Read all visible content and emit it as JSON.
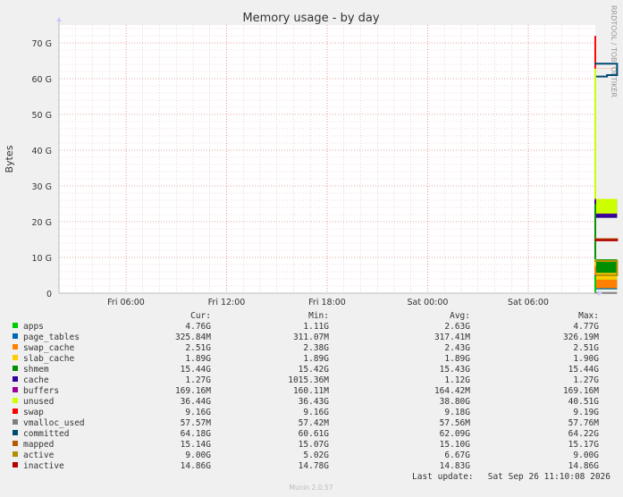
{
  "chart_data": {
    "type": "area",
    "title": "Memory usage - by day",
    "ylabel": "Bytes",
    "xlabel": "",
    "side_label": "RRDTOOL / TOBI OETIKER",
    "footer": "Munin 2.0.57",
    "ylim": [
      0,
      75
    ],
    "y_unit": "G",
    "y_ticks": [
      {
        "value": 0,
        "label": "0"
      },
      {
        "value": 10,
        "label": "10 G"
      },
      {
        "value": 20,
        "label": "20 G"
      },
      {
        "value": 30,
        "label": "30 G"
      },
      {
        "value": 40,
        "label": "40 G"
      },
      {
        "value": 50,
        "label": "50 G"
      },
      {
        "value": 60,
        "label": "60 G"
      },
      {
        "value": 70,
        "label": "70 G"
      }
    ],
    "x_hours_range": [
      0,
      32
    ],
    "x_ticks": [
      {
        "hour": 4,
        "label": "Fri 06:00"
      },
      {
        "hour": 10,
        "label": "Fri 12:00"
      },
      {
        "hour": 16,
        "label": "Fri 18:00"
      },
      {
        "hour": 22,
        "label": "Sat 00:00"
      },
      {
        "hour": 28,
        "label": "Sat 06:00"
      }
    ],
    "grid": true,
    "legend_headers": [
      "Cur:",
      "Min:",
      "Avg:",
      "Max:"
    ],
    "stack_hours": [
      32.05,
      32.7,
      33.3
    ],
    "series": [
      {
        "name": "apps",
        "color": "#00cc00",
        "kind": "area",
        "values": [
          1.1,
          1.1,
          4.76
        ],
        "cur": "4.76G",
        "min": "1.11G",
        "avg": "2.63G",
        "max": "4.77G"
      },
      {
        "name": "page_tables",
        "color": "#0066b3",
        "kind": "area",
        "values": [
          0.31,
          0.31,
          0.32
        ],
        "cur": "325.84M",
        "min": "311.07M",
        "avg": "317.41M",
        "max": "326.19M"
      },
      {
        "name": "swap_cache",
        "color": "#ff8000",
        "kind": "area",
        "values": [
          2.38,
          2.38,
          2.51
        ],
        "cur": "2.51G",
        "min": "2.38G",
        "avg": "2.43G",
        "max": "2.51G"
      },
      {
        "name": "slab_cache",
        "color": "#ffcc00",
        "kind": "area",
        "values": [
          1.89,
          1.89,
          1.89
        ],
        "cur": "1.89G",
        "min": "1.89G",
        "avg": "1.89G",
        "max": "1.90G"
      },
      {
        "name": "shmem",
        "color": "#008f00",
        "kind": "area",
        "values": [
          15.42,
          15.42,
          15.44
        ],
        "cur": "15.44G",
        "min": "15.42G",
        "avg": "15.43G",
        "max": "15.44G"
      },
      {
        "name": "cache",
        "color": "#330099",
        "kind": "area",
        "values": [
          1.02,
          1.02,
          1.27
        ],
        "cur": "1.27G",
        "min": "1015.36M",
        "avg": "1.12G",
        "max": "1.27G"
      },
      {
        "name": "buffers",
        "color": "#990099",
        "kind": "area",
        "values": [
          0.16,
          0.16,
          0.17
        ],
        "cur": "169.16M",
        "min": "160.11M",
        "avg": "164.42M",
        "max": "169.16M"
      },
      {
        "name": "unused",
        "color": "#ccff00",
        "kind": "area",
        "values": [
          40.5,
          40.5,
          36.44
        ],
        "cur": "36.44G",
        "min": "36.43G",
        "avg": "38.80G",
        "max": "40.51G"
      },
      {
        "name": "swap",
        "color": "#ff0000",
        "kind": "area",
        "values": [
          9.18,
          9.18,
          9.16
        ],
        "cur": "9.16G",
        "min": "9.16G",
        "avg": "9.18G",
        "max": "9.19G"
      },
      {
        "name": "vmalloc_used",
        "color": "#808080",
        "kind": "line",
        "values": [
          0.058,
          0.058,
          0.058
        ],
        "cur": "57.57M",
        "min": "57.42M",
        "avg": "57.56M",
        "max": "57.76M"
      },
      {
        "name": "committed",
        "color": "#004b73",
        "kind": "line",
        "values": [
          60.6,
          61.0,
          64.18
        ],
        "cur": "64.18G",
        "min": "60.61G",
        "avg": "62.09G",
        "max": "64.22G"
      },
      {
        "name": "mapped",
        "color": "#b35a00",
        "kind": "line",
        "values": [
          15.07,
          15.1,
          15.14
        ],
        "cur": "15.14G",
        "min": "15.07G",
        "avg": "15.10G",
        "max": "15.17G"
      },
      {
        "name": "active",
        "color": "#b38f00",
        "kind": "line",
        "values": [
          5.02,
          5.02,
          9.0
        ],
        "cur": "9.00G",
        "min": "5.02G",
        "avg": "6.67G",
        "max": "9.00G"
      },
      {
        "name": "inactive",
        "color": "#b30000",
        "kind": "line",
        "values": [
          14.78,
          14.78,
          14.86
        ],
        "cur": "14.86G",
        "min": "14.78G",
        "avg": "14.83G",
        "max": "14.86G"
      }
    ],
    "last_update_label": "Last update:",
    "last_update": "Sat Sep 26 11:10:08 2026"
  }
}
